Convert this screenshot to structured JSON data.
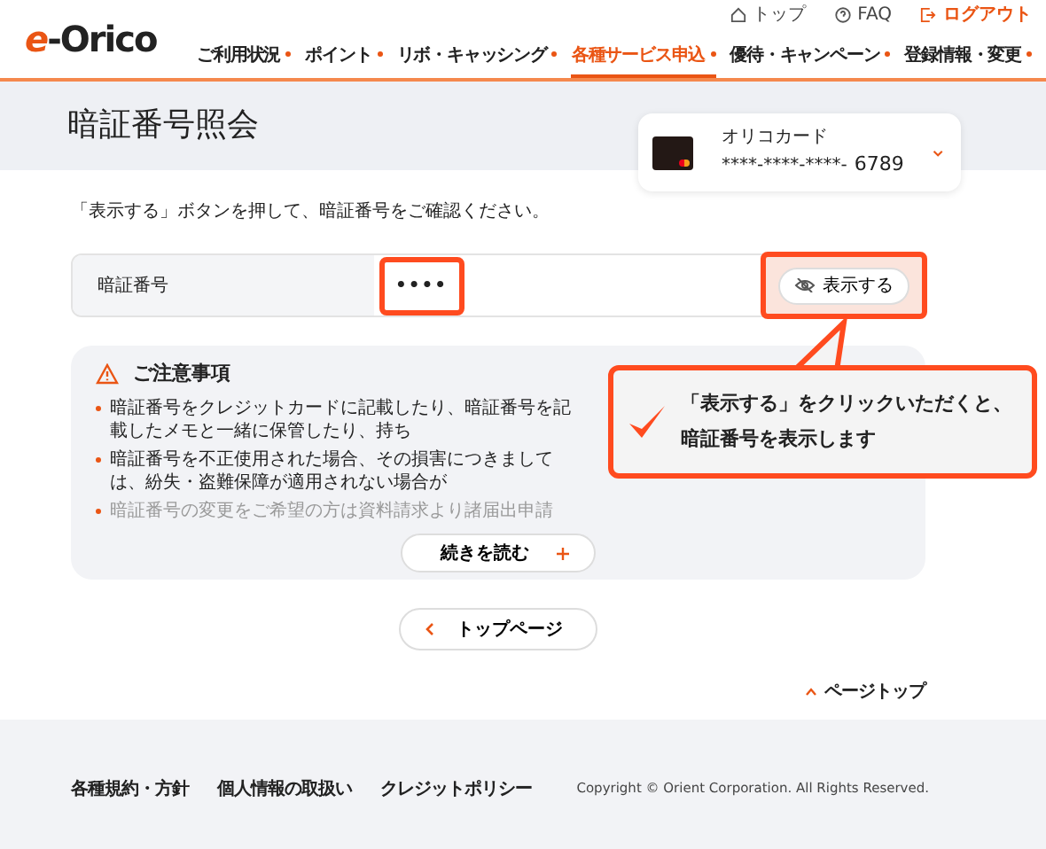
{
  "header": {
    "logo": {
      "mark": "e",
      "name": "-Orico"
    },
    "utility_links": [
      {
        "kind": "home",
        "label": "トップ"
      },
      {
        "kind": "help",
        "label": "FAQ"
      },
      {
        "kind": "logout",
        "label": "ログアウト"
      }
    ],
    "nav": [
      {
        "label": "ご利用状況",
        "selected": false
      },
      {
        "label": "ポイント",
        "selected": false
      },
      {
        "label": "リボ・キャッシング",
        "selected": false
      },
      {
        "label": "各種サービス申込",
        "selected": true
      },
      {
        "label": "優待・キャンペーン",
        "selected": false
      },
      {
        "label": "登録情報・変更",
        "selected": false
      }
    ]
  },
  "page_title": "暗証番号照会",
  "card_selector": {
    "name": "オリコカード",
    "number": "****-****-****-",
    "last_digits": "6789"
  },
  "instruction": "「表示する」ボタンを押して、暗証番号をご確認ください。",
  "pin_row": {
    "label": "暗証番号",
    "value": "••••",
    "button": "表示する"
  },
  "notes": {
    "title": "ご注意事項",
    "items": [
      {
        "text": "暗証番号をクレジットカードに記載したり、暗証番号を記載したメモと一緒に保管したり、持ち",
        "faded": false
      },
      {
        "text": "暗証番号を不正使用された場合、その損害につきましては、紛失・盗難保障が適用されない場合が",
        "faded": false
      },
      {
        "text": "暗証番号の変更をご希望の方は資料請求より諸届出申請",
        "faded": true
      }
    ],
    "read_more": "続きを読む"
  },
  "top_page_button": "トップページ",
  "page_top": "ページトップ",
  "footer": {
    "links": [
      "各種規約・方針",
      "個人情報の取扱い",
      "クレジットポリシー"
    ],
    "copyright": "Copyright © Orient Corporation. All Rights Reserved."
  },
  "callout": {
    "lines": [
      "「表示する」をクリックいただくと、",
      "暗証番号を表示します"
    ]
  }
}
